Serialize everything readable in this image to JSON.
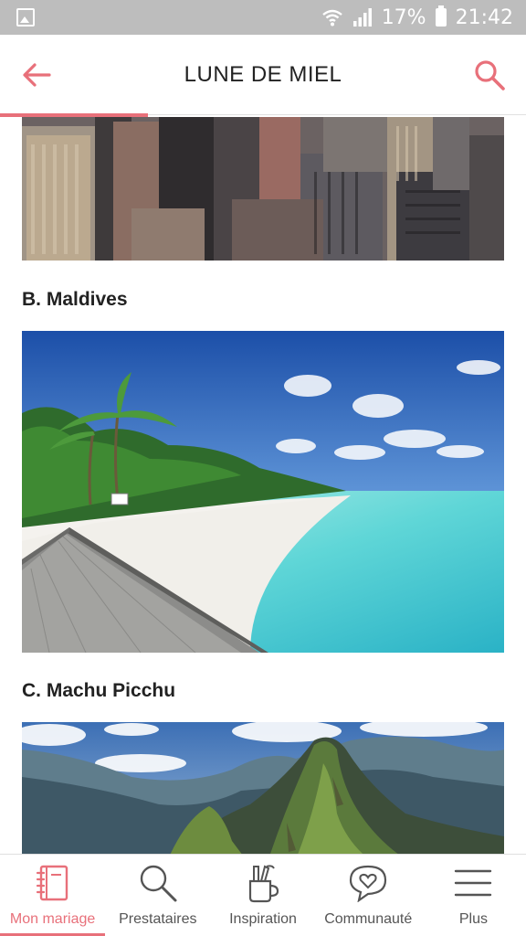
{
  "status_bar": {
    "battery_percent": "17%",
    "time": "21:42"
  },
  "header": {
    "title": "LUNE DE MIEL"
  },
  "sections": [
    {
      "title": "B. Maldives"
    },
    {
      "title": "C. Machu Picchu"
    }
  ],
  "bottom_nav": {
    "items": [
      {
        "label": "Mon mariage",
        "icon": "notebook-icon",
        "active": true
      },
      {
        "label": "Prestataires",
        "icon": "search-icon",
        "active": false
      },
      {
        "label": "Inspiration",
        "icon": "brushes-cup-icon",
        "active": false
      },
      {
        "label": "Communauté",
        "icon": "heart-chat-icon",
        "active": false
      },
      {
        "label": "Plus",
        "icon": "menu-icon",
        "active": false
      }
    ]
  },
  "colors": {
    "accent": "#e8707a",
    "status_bar": "#bdbdbd"
  }
}
